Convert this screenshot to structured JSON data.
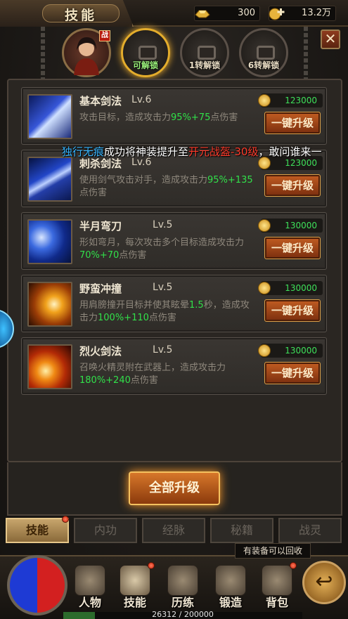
{
  "header": {
    "title": "技能"
  },
  "resources": [
    {
      "icon": "gold-ingot-icon",
      "value": "300"
    },
    {
      "icon": "gold-plus-icon",
      "value": "13.2万"
    }
  ],
  "hero_slots": [
    {
      "label": "",
      "badge": "战"
    },
    {
      "label": "可解锁"
    },
    {
      "label": "1转解锁"
    },
    {
      "label": "6转解锁"
    }
  ],
  "broadcast": {
    "player": "独行无痕",
    "text1": "成功将神装提升至",
    "item": "开元战盔-30级",
    "text2": "，敢问谁来一"
  },
  "skills": [
    {
      "name": "基本剑法",
      "level": "Lv.6",
      "cost": "123000",
      "button": "一键升级",
      "desc_pre": "攻击目标，造成攻击力",
      "desc_value": "95%+75",
      "desc_post": "点伤害"
    },
    {
      "name": "刺杀剑法",
      "level": "Lv.6",
      "cost": "123000",
      "button": "一键升级",
      "desc_pre": "使用剑气攻击对手，造成攻击力",
      "desc_value": "95%+135",
      "desc_post": "点伤害"
    },
    {
      "name": "半月弯刀",
      "level": "Lv.5",
      "cost": "130000",
      "button": "一键升级",
      "desc_pre": "形如弯月，每次攻击多个目标造成攻击力",
      "desc_value": "70%+70",
      "desc_post": "点伤害"
    },
    {
      "name": "野蛮冲撞",
      "level": "Lv.5",
      "cost": "130000",
      "button": "一键升级",
      "desc_pre": "用肩膀撞开目标并使其眩晕",
      "desc_value": "1.5",
      "desc_mid": "秒，造成攻击力",
      "desc_value2": "100%+110",
      "desc_post": "点伤害"
    },
    {
      "name": "烈火剑法",
      "level": "Lv.5",
      "cost": "130000",
      "button": "一键升级",
      "desc_pre": "召唤火精灵附在武器上，造成攻击力",
      "desc_value": "180%+240",
      "desc_post": "点伤害"
    }
  ],
  "upgrade_all": "全部升级",
  "tabs": [
    "技能",
    "内功",
    "经脉",
    "秘籍",
    "战灵"
  ],
  "tooltip": "有装备可以回收",
  "nav": [
    "人物",
    "技能",
    "历练",
    "锻造",
    "背包"
  ],
  "exp": {
    "text": "26312 / 200000",
    "fraction": 0.13156
  },
  "colors": {
    "highlight_green": "#31e04a",
    "red_item": "#ff3b2b",
    "player_blue": "#36b5ff",
    "button_orange": "#c25d22"
  }
}
